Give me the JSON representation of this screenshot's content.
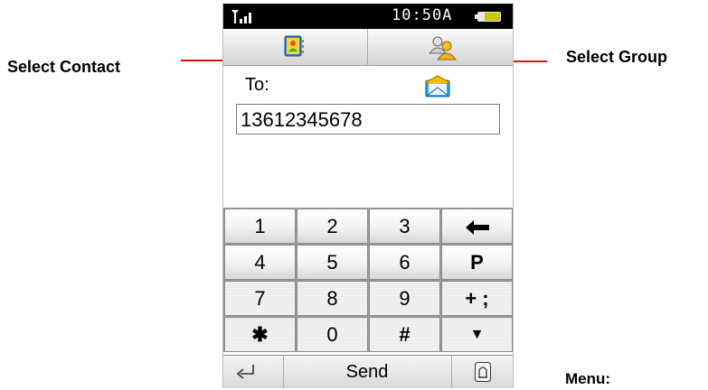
{
  "annotations": {
    "select_contact": "Select Contact",
    "select_group": "Select Group",
    "menu": "Menu:"
  },
  "status_bar": {
    "time": "10:50A"
  },
  "compose": {
    "to_label": "To:",
    "recipient_value": "13612345678"
  },
  "keypad": {
    "rows": [
      [
        "1",
        "2",
        "3",
        "←"
      ],
      [
        "4",
        "5",
        "6",
        "P"
      ],
      [
        "7",
        "8",
        "9",
        "+ ;"
      ],
      [
        "✱",
        "0",
        "#",
        "▼"
      ]
    ]
  },
  "bottom_bar": {
    "send_label": "Send"
  },
  "colors": {
    "annotation_line": "#e01010",
    "status_bar_bg": "#000000",
    "battery_fill": "#c8c800",
    "envelope_flap": "#f0c000",
    "envelope_body": "#2fa8e8"
  },
  "icons": {
    "contact_tab": "contact-book-icon",
    "group_tab": "group-people-icon",
    "message_type": "envelope-icon",
    "back": "back-arrow-icon",
    "menu": "menu-icon"
  }
}
